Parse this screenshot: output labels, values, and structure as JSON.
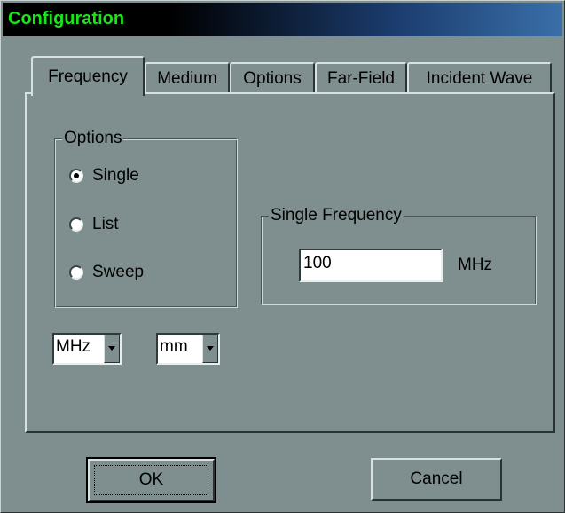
{
  "window": {
    "title": "Configuration"
  },
  "tabs": [
    {
      "label": "Frequency",
      "active": true
    },
    {
      "label": "Medium",
      "active": false
    },
    {
      "label": "Options",
      "active": false
    },
    {
      "label": "Far-Field",
      "active": false
    },
    {
      "label": "Incident Wave",
      "active": false
    }
  ],
  "options_group": {
    "legend": "Options",
    "radios": [
      {
        "label": "Single",
        "selected": true
      },
      {
        "label": "List",
        "selected": false
      },
      {
        "label": "Sweep",
        "selected": false
      }
    ]
  },
  "single_frequency": {
    "legend": "Single Frequency",
    "value": "100",
    "unit": "MHz"
  },
  "unit_selects": {
    "frequency_unit": "MHz",
    "length_unit": "mm"
  },
  "buttons": {
    "ok": "OK",
    "cancel": "Cancel"
  }
}
